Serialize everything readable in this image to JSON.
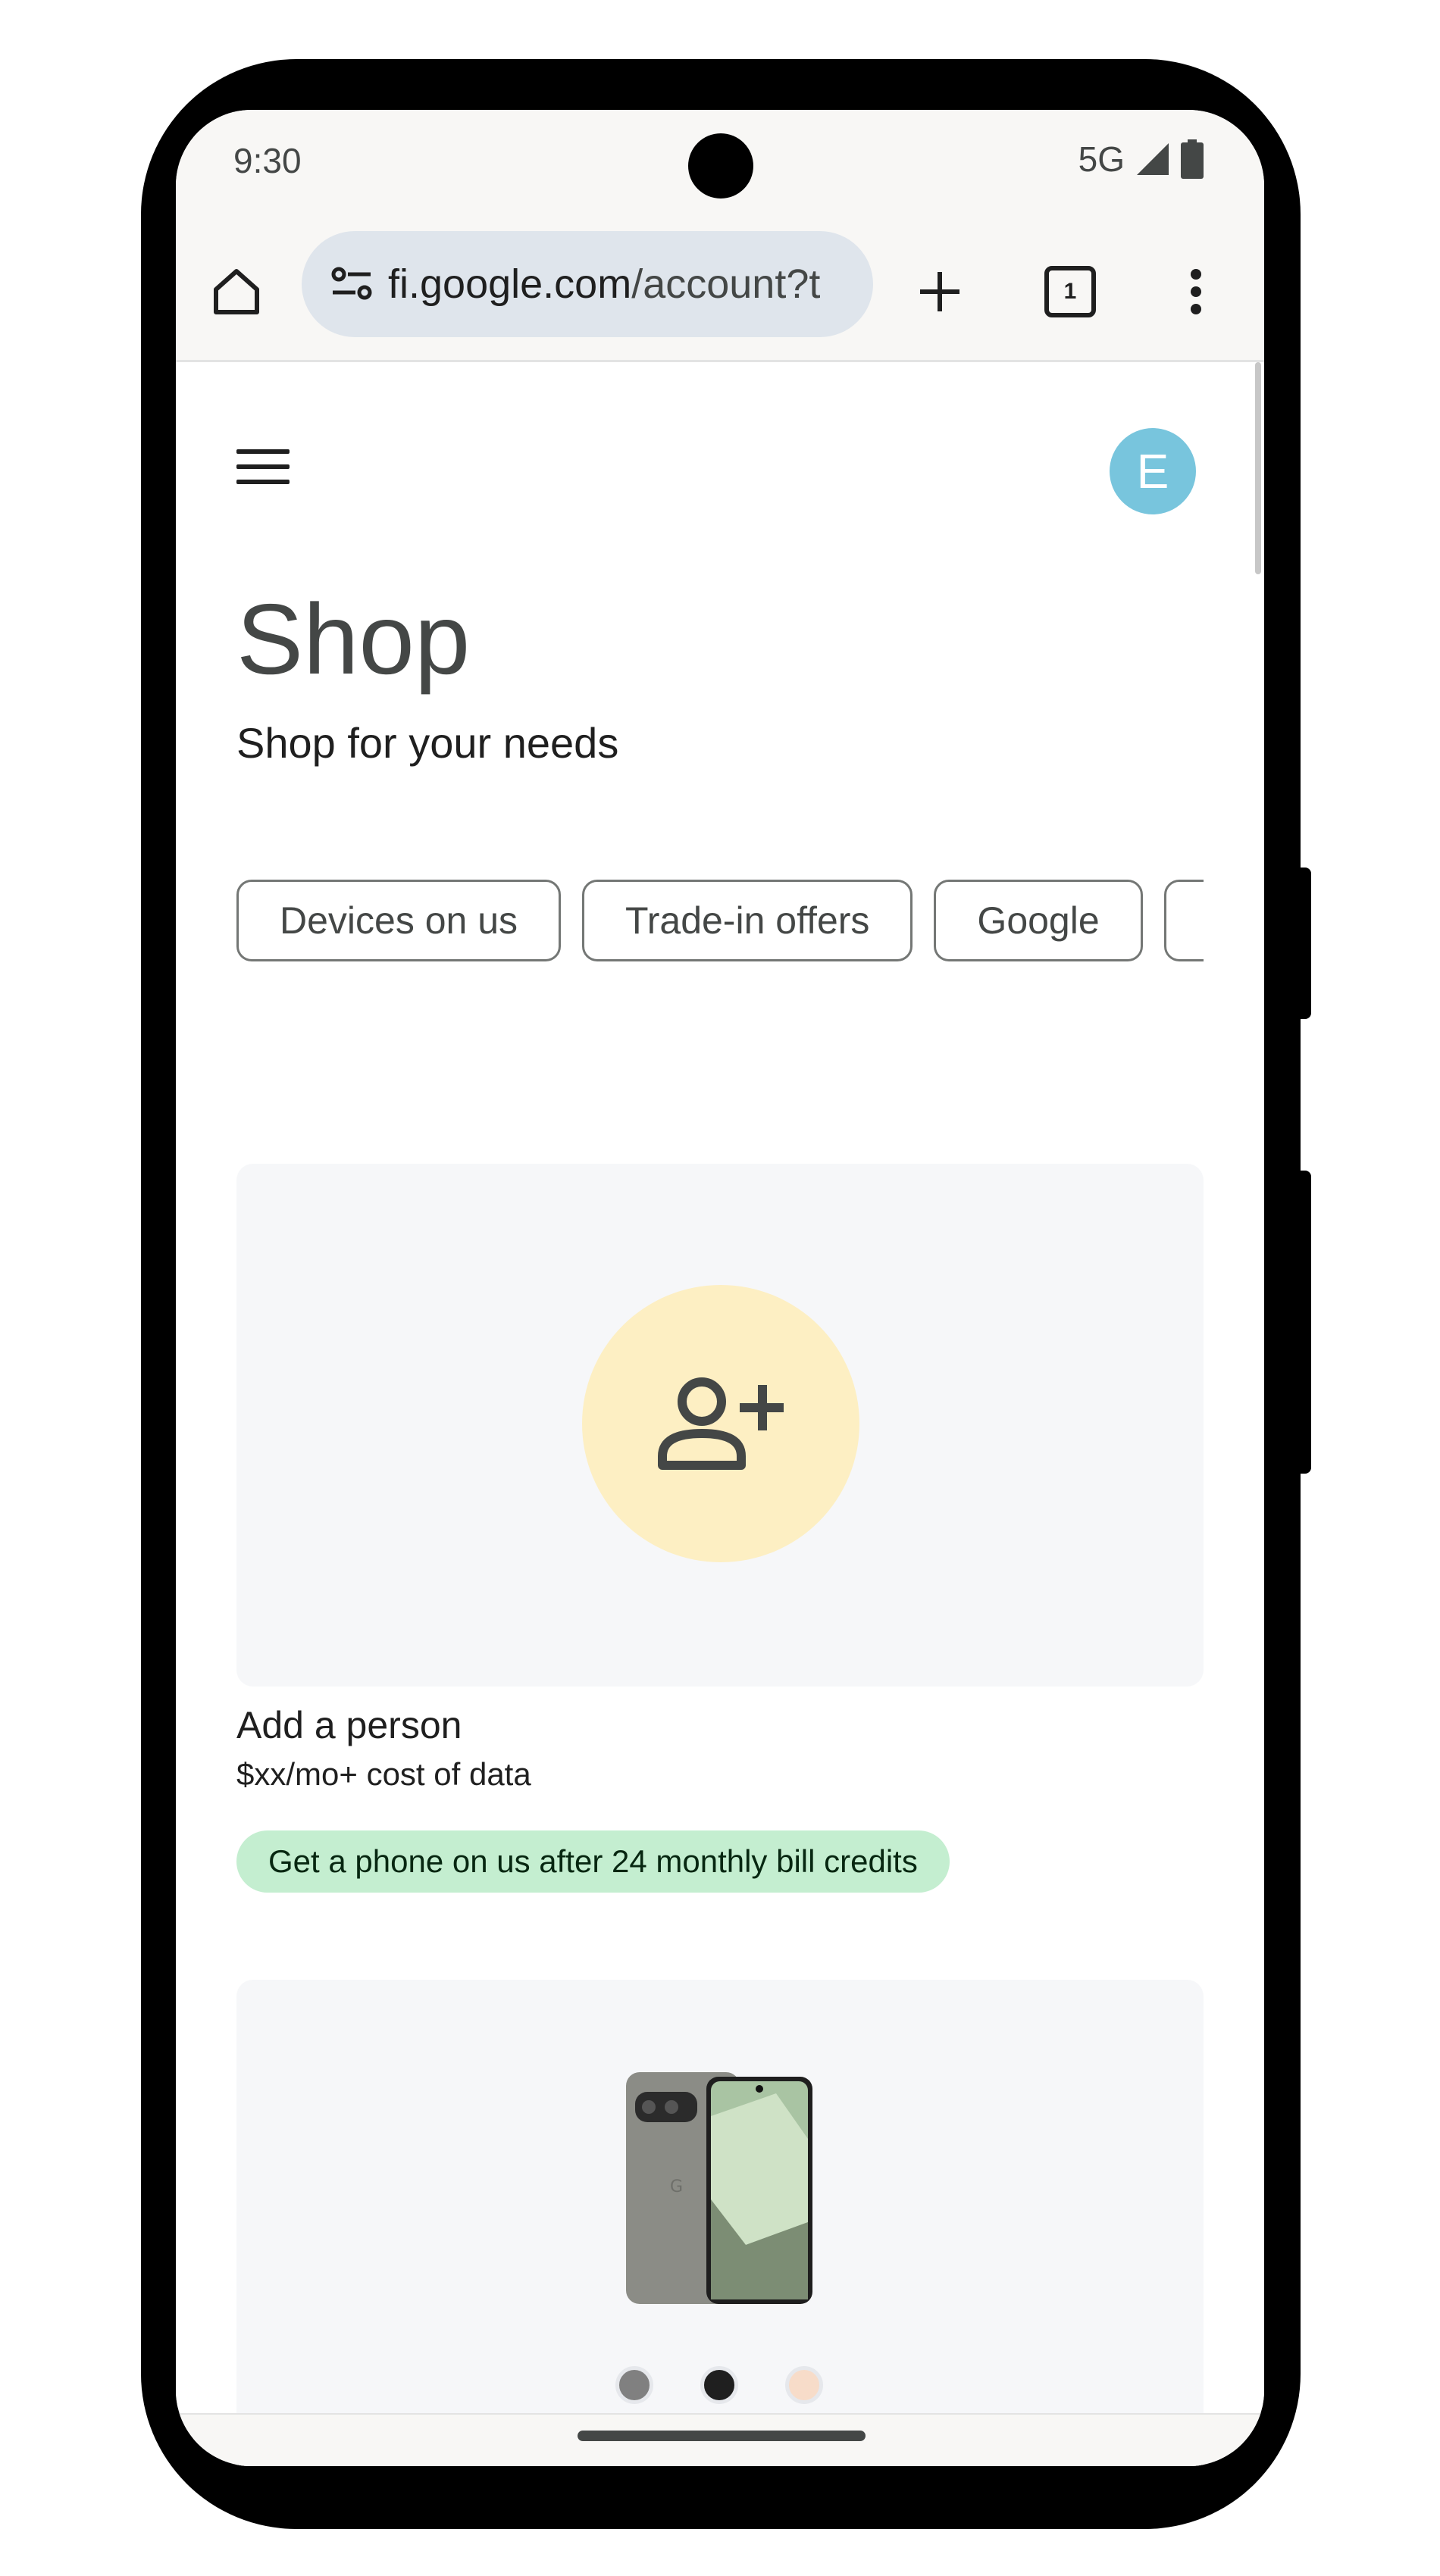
{
  "status_bar": {
    "time": "9:30",
    "network": "5G"
  },
  "browser": {
    "url_domain": "fi.google.com",
    "url_path": "/account?t",
    "tab_count": "1"
  },
  "header": {
    "avatar_initial": "E"
  },
  "page": {
    "title": "Shop",
    "subtitle": "Shop for your needs"
  },
  "chips": [
    "Devices on us",
    "Trade-in offers",
    "Google",
    ""
  ],
  "card1": {
    "icon": "person-add-icon",
    "title": "Add a person",
    "price": "$xx/mo+ cost of data",
    "promo": "Get a phone on us after 24 monthly bill credits"
  },
  "card2": {
    "image": "pixel-phone",
    "color_options": [
      "#808080",
      "#1f1f1f",
      "#f7dcc9"
    ]
  },
  "colors": {
    "avatar": "#78c5dd",
    "promo_bg": "#c4eed0",
    "add_circle": "#fdefc3"
  }
}
